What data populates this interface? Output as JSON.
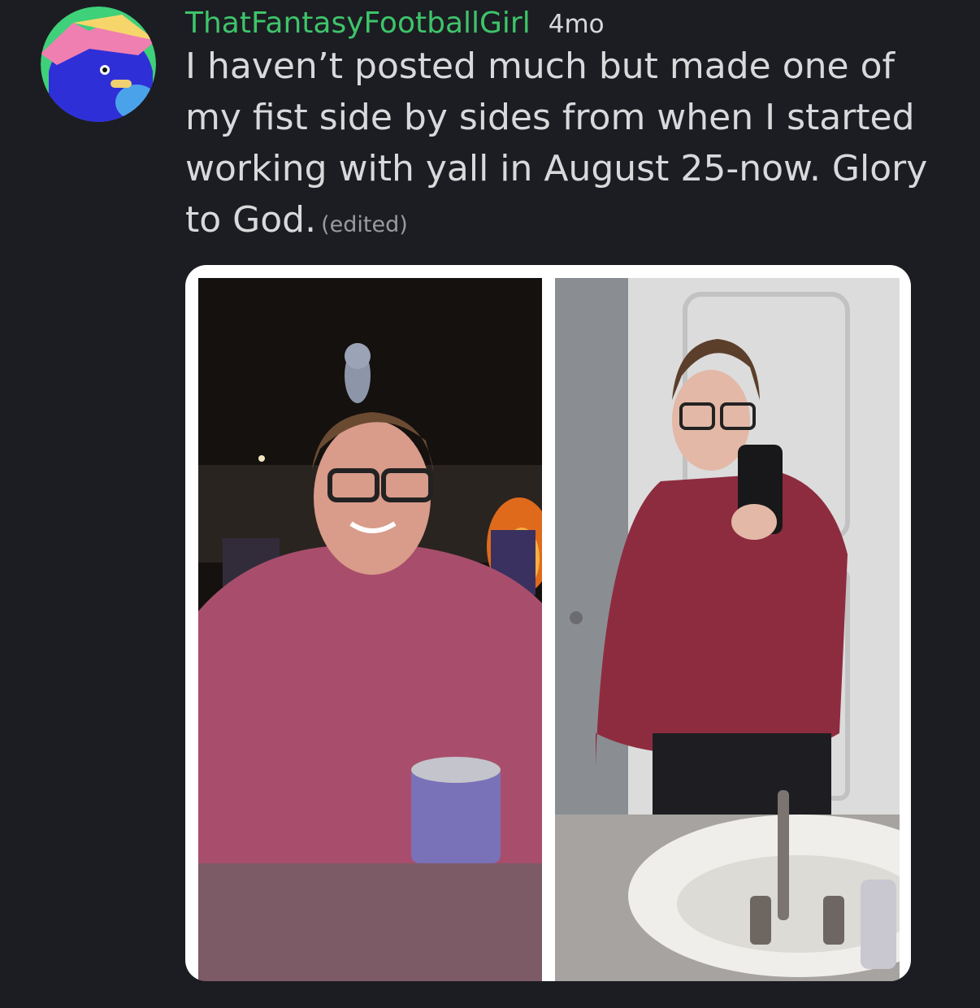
{
  "post": {
    "author": "ThatFantasyFootballGirl",
    "timestamp": "4mo",
    "message": "I haven’t posted much but made one of my fist side by sides from when I started working with yall in August 25-now. Glory to God.",
    "edited_label": "(edited)"
  },
  "avatar": {
    "icon": "blue-bird-with-pink-hat-icon",
    "bg": "#3fd07a",
    "body": "#2f2fd8",
    "hat": "#ef7fb0"
  },
  "attachment": {
    "left_photo": {
      "icon": "before-photo-campfire-night",
      "shirt": "#a84e6c"
    },
    "right_photo": {
      "icon": "after-photo-mirror-selfie",
      "shirt": "#8e2c3f"
    }
  },
  "colors": {
    "background": "#1c1d22",
    "username": "#3ec46a",
    "text": "#d9d9dc",
    "muted": "#9a9ba0"
  }
}
